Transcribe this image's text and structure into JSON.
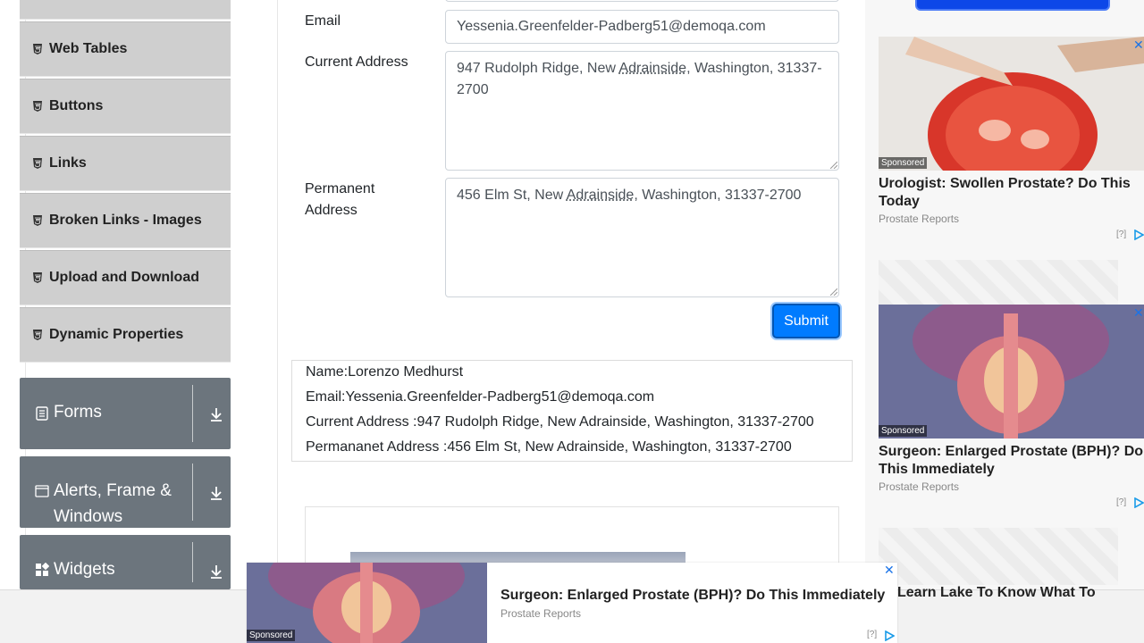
{
  "sidebar": {
    "elements_items": [
      {
        "label": ""
      },
      {
        "label": "Web Tables"
      },
      {
        "label": "Buttons"
      },
      {
        "label": "Links"
      },
      {
        "label": "Broken Links - Images"
      },
      {
        "label": "Upload and Download"
      },
      {
        "label": "Dynamic Properties"
      }
    ],
    "groups": [
      {
        "label": "Forms"
      },
      {
        "label": "Alerts, Frame & Windows"
      },
      {
        "label": "Widgets"
      }
    ]
  },
  "form": {
    "email_label": "Email",
    "email_value": "Yessenia.Greenfelder-Padberg51@demoqa.com",
    "current_address_label": "Current Address",
    "current_address_value_pre": "947 Rudolph Ridge, New ",
    "current_address_value_u": "Adrainside",
    "current_address_value_post": ", Washington, 31337-2700",
    "permanent_address_label": "Permanent Address",
    "permanent_address_value_pre": "456 Elm St, New ",
    "permanent_address_value_u": "Adrainside",
    "permanent_address_value_post": ", Washington, 31337-2700",
    "submit_label": "Submit"
  },
  "output": {
    "name": "Name:Lorenzo Medhurst",
    "email": "Email:Yessenia.Greenfelder-Padberg51@demoqa.com",
    "current_address": "Current Address :947 Rudolph Ridge, New Adrainside, Washington, 31337-2700",
    "permanent_address": "Permananet Address :456 Elm St, New Adrainside, Washington, 31337-2700"
  },
  "ads": {
    "right": [
      {
        "sponsored": "Sponsored",
        "title": "Urologist: Swollen Prostate? Do This Today",
        "source": "Prostate Reports",
        "help": "[?]"
      },
      {
        "sponsored": "Sponsored",
        "title": "Surgeon: Enlarged Prostate (BPH)? Do This Immediately",
        "source": "Prostate Reports",
        "help": "[?]"
      }
    ],
    "peek_title": "Learn Lake To Know What To",
    "bottom": {
      "sponsored": "Sponsored",
      "title": "Surgeon: Enlarged Prostate (BPH)? Do This Immediately",
      "source": "Prostate Reports",
      "help": "[?]",
      "close": "✕"
    }
  },
  "colors": {
    "primary": "#007bff",
    "group_bg": "#6c757d",
    "item_bg": "#cfcfcf"
  }
}
